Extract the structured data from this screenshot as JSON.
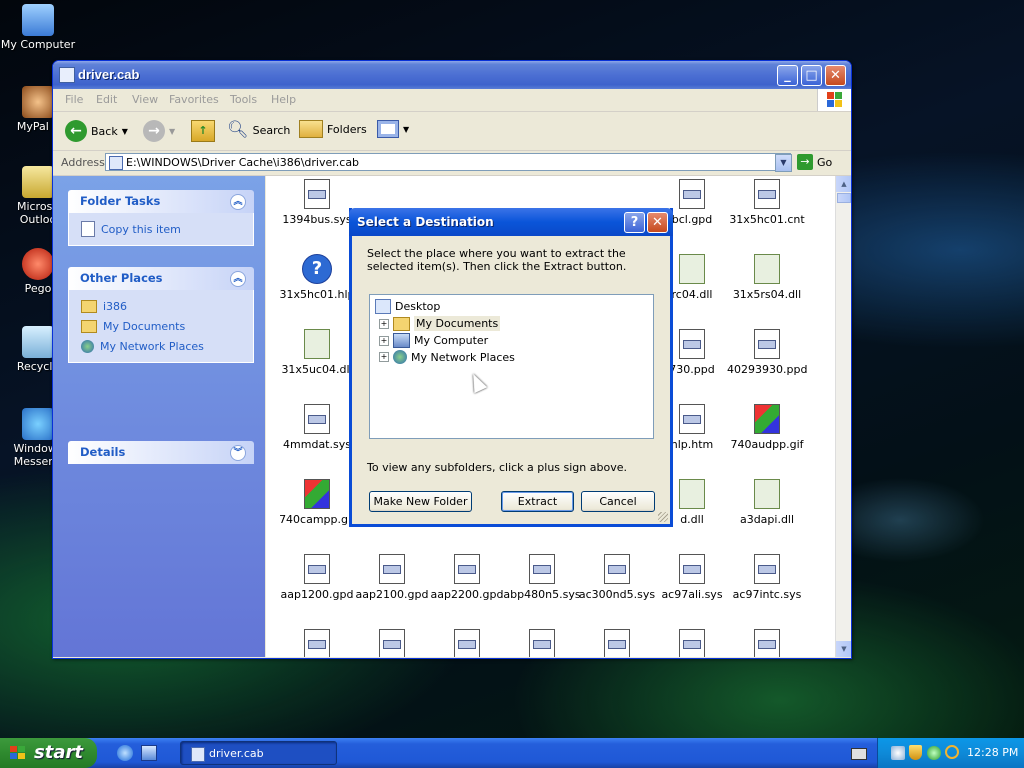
{
  "desktop": {
    "icons": [
      {
        "label": "My Computer"
      },
      {
        "label": "MyPal e"
      },
      {
        "label": "Microso Outloo"
      },
      {
        "label": "Pego"
      },
      {
        "label": "Recycle"
      },
      {
        "label": "Windows Messeng"
      }
    ]
  },
  "window": {
    "title": "driver.cab",
    "menu": [
      "File",
      "Edit",
      "View",
      "Favorites",
      "Tools",
      "Help"
    ],
    "toolbar": {
      "back": "Back",
      "search": "Search",
      "folders": "Folders"
    },
    "address": {
      "label": "Address",
      "value": "E:\\WINDOWS\\Driver Cache\\i386\\driver.cab",
      "go": "Go"
    },
    "folder_tasks": {
      "title": "Folder Tasks",
      "items": [
        "Copy this item"
      ]
    },
    "other_places": {
      "title": "Other Places",
      "items": [
        "i386",
        "My Documents",
        "My Network Places"
      ]
    },
    "details": {
      "title": "Details"
    },
    "files": [
      "1394bus.sys",
      "31x5hc01.cnt",
      "31x5hc01.hlp",
      "31x5rs04.dll",
      "31x5uc04.dll",
      "40293930.ppd",
      "4mmdat.sys",
      "740audpp.gif",
      "740campp.gif",
      "a3dapi.dll",
      "aap1200.gpd",
      "aap2100.gpd",
      "aap2200.gpd",
      "abp480n5.sys",
      "ac300nd5.sys",
      "ac97ali.sys",
      "ac97intc.sys"
    ],
    "partial_files": [
      "bcl.gpd",
      "rc04.dll",
      "730.ppd",
      "hlp.htm",
      "d.dll"
    ]
  },
  "dialog": {
    "title": "Select a Destination",
    "instruction": "Select the place where you want to extract the selected item(s).  Then click the Extract button.",
    "tree": {
      "root": "Desktop",
      "children": [
        "My Documents",
        "My Computer",
        "My Network Places"
      ]
    },
    "hint": "To view any subfolders, click a plus sign above.",
    "buttons": {
      "new_folder": "Make New Folder",
      "extract": "Extract",
      "cancel": "Cancel"
    }
  },
  "taskbar": {
    "start": "start",
    "task": "driver.cab",
    "clock": "12:28 PM"
  },
  "colors": {
    "titlebar": "#3e63cc",
    "taskbar": "#245edb",
    "start": "#2f8a2f",
    "tray": "#0e8ad8"
  }
}
